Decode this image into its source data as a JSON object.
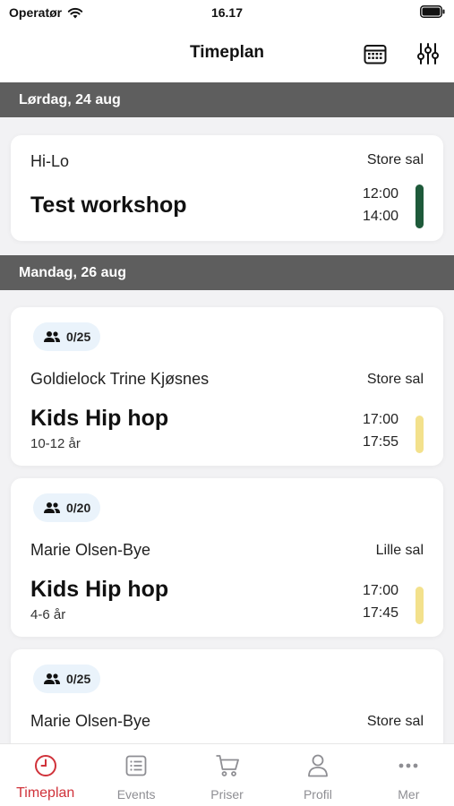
{
  "status_bar": {
    "carrier": "Operatør",
    "time": "16.17"
  },
  "header": {
    "title": "Timeplan",
    "calendar_icon": "calendar-icon",
    "filter_icon": "sliders-icon"
  },
  "sections": [
    {
      "date": "Lørdag, 24 aug",
      "items": [
        {
          "teacher": "Hi-Lo",
          "room": "Store sal",
          "name": "Test workshop",
          "start": "12:00",
          "end": "14:00",
          "color": "#1e5a3a"
        }
      ]
    },
    {
      "date": "Mandag, 26 aug",
      "items": [
        {
          "capacity": "0/25",
          "teacher": "Goldielock Trine Kjøsnes",
          "room": "Store sal",
          "name": "Kids Hip hop",
          "age": "10-12 år",
          "start": "17:00",
          "end": "17:55",
          "color": "#f3e18c"
        },
        {
          "capacity": "0/20",
          "teacher": "Marie Olsen-Bye",
          "room": "Lille sal",
          "name": "Kids Hip hop",
          "age": "4-6 år",
          "start": "17:00",
          "end": "17:45",
          "color": "#f3e18c"
        },
        {
          "capacity": "0/25",
          "teacher": "Marie Olsen-Bye",
          "room": "Store sal"
        }
      ]
    }
  ],
  "tab_bar": {
    "active_color": "#d0323a",
    "items": [
      {
        "label": "Timeplan",
        "icon": "clock-icon"
      },
      {
        "label": "Events",
        "icon": "list-icon"
      },
      {
        "label": "Priser",
        "icon": "cart-icon"
      },
      {
        "label": "Profil",
        "icon": "person-icon"
      },
      {
        "label": "Mer",
        "icon": "more-icon"
      }
    ]
  }
}
